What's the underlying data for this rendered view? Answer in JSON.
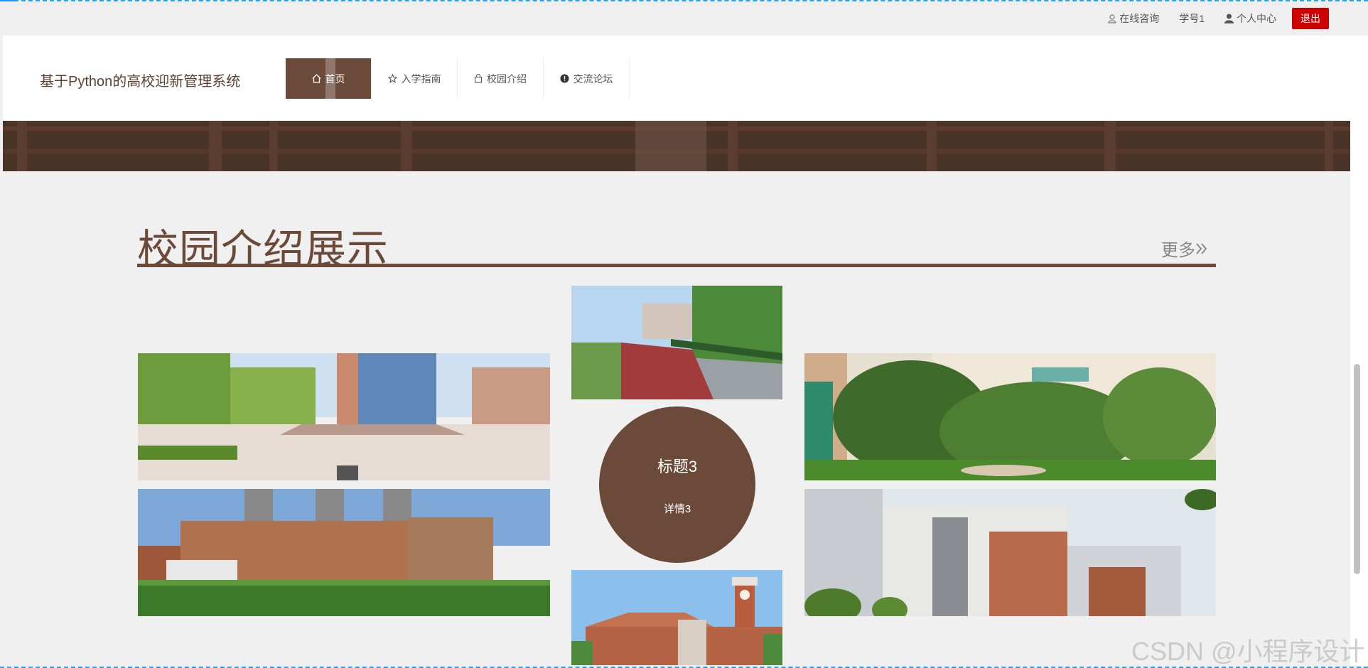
{
  "topbar": {
    "consult": "在线咨询",
    "student_id": "学号1",
    "personal_center": "个人中心",
    "logout": "退出"
  },
  "header": {
    "site_title": "基于Python的高校迎新管理系统",
    "nav": [
      {
        "label": "首页",
        "icon": "home-icon"
      },
      {
        "label": "入学指南",
        "icon": "star-icon"
      },
      {
        "label": "校园介绍",
        "icon": "bag-icon"
      },
      {
        "label": "交流论坛",
        "icon": "info-circle-icon"
      }
    ]
  },
  "section": {
    "title": "校园介绍展示",
    "more": "更多"
  },
  "featured": {
    "title": "标题3",
    "detail": "详情3"
  },
  "colors": {
    "accent": "#6b4a3a",
    "logout": "#cc0000",
    "page_bg": "#f0f0f0"
  },
  "watermark": "CSDN @小程序设计"
}
